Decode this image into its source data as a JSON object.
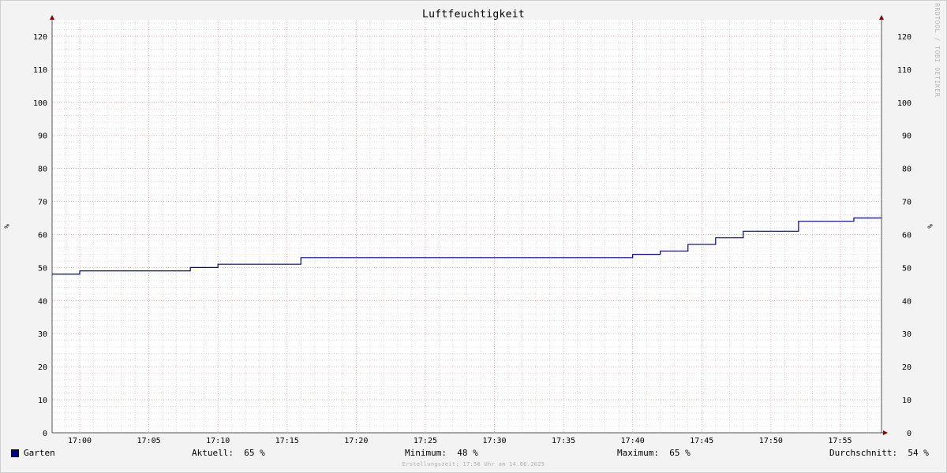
{
  "watermark": "RRDTOOL / TOBI OETIKER",
  "unit_label": "%",
  "chart_data": {
    "type": "line",
    "title": "Luftfeuchtigkeit",
    "ylabel": "%",
    "xlabel": "",
    "ylim": [
      0,
      125
    ],
    "yticks": [
      0,
      10,
      20,
      30,
      40,
      50,
      60,
      70,
      80,
      90,
      100,
      110,
      120
    ],
    "xlim": [
      "16:58",
      "17:58"
    ],
    "xticks": [
      "17:00",
      "17:05",
      "17:10",
      "17:15",
      "17:20",
      "17:25",
      "17:30",
      "17:35",
      "17:40",
      "17:45",
      "17:50",
      "17:55"
    ],
    "grid": true,
    "series": [
      {
        "name": "Garten",
        "color": "#00008b",
        "step": true,
        "points": [
          [
            "16:58",
            48
          ],
          [
            "17:00",
            49
          ],
          [
            "17:08",
            50
          ],
          [
            "17:10",
            51
          ],
          [
            "17:16",
            53
          ],
          [
            "17:40",
            54
          ],
          [
            "17:42",
            55
          ],
          [
            "17:44",
            57
          ],
          [
            "17:46",
            59
          ],
          [
            "17:48",
            61
          ],
          [
            "17:52",
            64
          ],
          [
            "17:56",
            65
          ],
          [
            "17:58",
            65
          ]
        ]
      }
    ]
  },
  "legend": {
    "series_name": "Garten",
    "current_label": "Aktuell:",
    "current_value": "65 %",
    "min_label": "Minimum:",
    "min_value": "48 %",
    "max_label": "Maximum:",
    "max_value": "65 %",
    "avg_label": "Durchschnitt:",
    "avg_value": "54 %"
  },
  "footer": "Erstellungszeit: 17:58 Uhr am 14.06.2025",
  "colors": {
    "line": "#00008b",
    "major_grid": "#e6a0a8",
    "minor_grid": "#cccccc",
    "axis": "#555555",
    "arrow": "#8b0000",
    "plot_bg": "#ffffff"
  }
}
